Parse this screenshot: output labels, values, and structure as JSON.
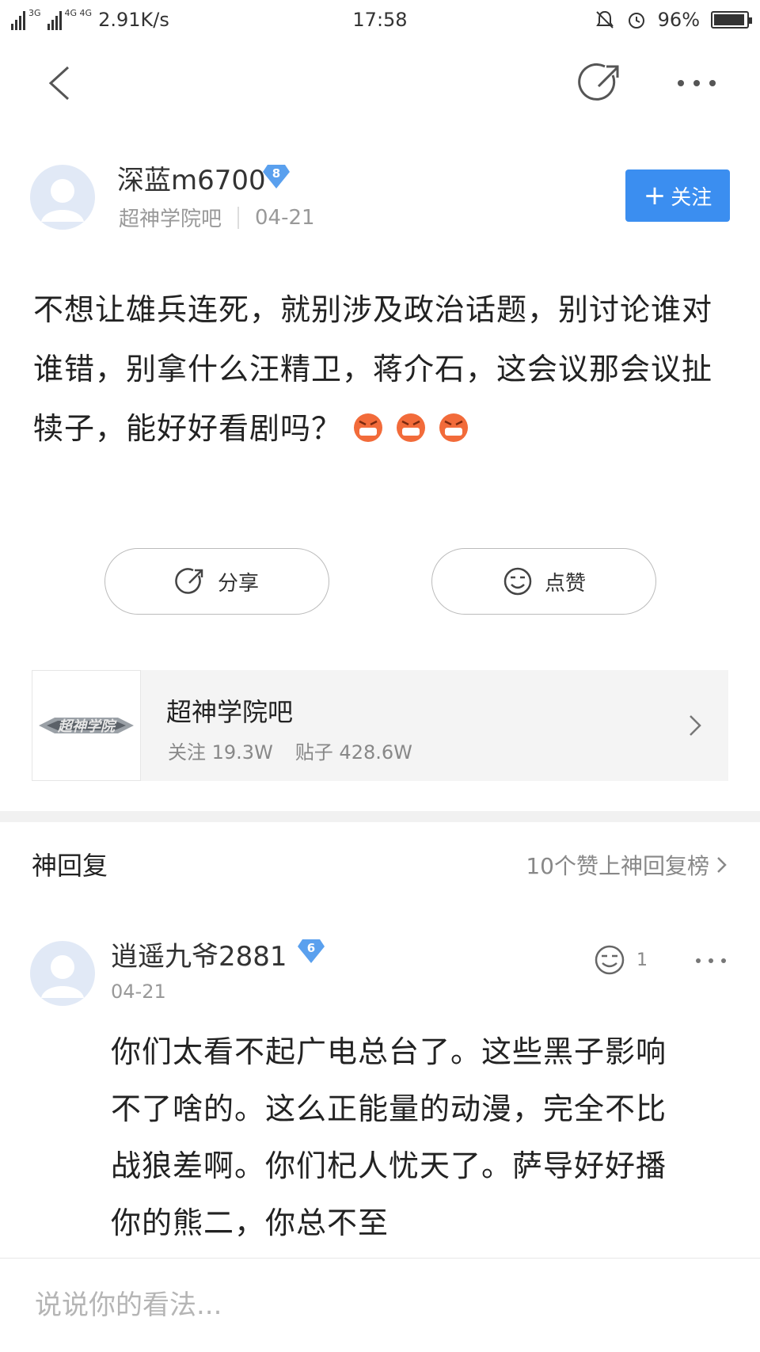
{
  "status_bar": {
    "network_1": "3G",
    "network_2": "4G 4G",
    "speed": "2.91K/s",
    "time": "17:58",
    "battery": "96%",
    "battery_level": 0.96
  },
  "post": {
    "author": "深蓝m6700",
    "author_level": "8",
    "forum": "超神学院吧",
    "date": "04-21",
    "follow_label": "关注",
    "body": "不想让雄兵连死，就别涉及政治话题，别讨论谁对谁错，别拿什么汪精卫，蒋介石，这会议那会议扯犊子，能好好看剧吗？",
    "share_label": "分享",
    "like_label": "点赞"
  },
  "forum_card": {
    "logo_text": "超神学院",
    "name": "超神学院吧",
    "followers": "关注 19.3W",
    "posts": "贴子 428.6W"
  },
  "god_replies": {
    "title": "神回复",
    "link": "10个赞上神回复榜"
  },
  "reply": {
    "author": "逍遥九爷2881",
    "author_level": "6",
    "date": "04-21",
    "likes": "1",
    "body": "你们太看不起广电总台了。这些黑子影响不了啥的。这么正能量的动漫，完全不比战狼差啊。你们杞人忧天了。萨导好好播你的熊二，你总不至"
  },
  "comment": {
    "placeholder": "说说你的看法..."
  },
  "colors": {
    "accent": "#3b8ef0",
    "badge": "#5aa0ee",
    "muted": "#999999"
  }
}
